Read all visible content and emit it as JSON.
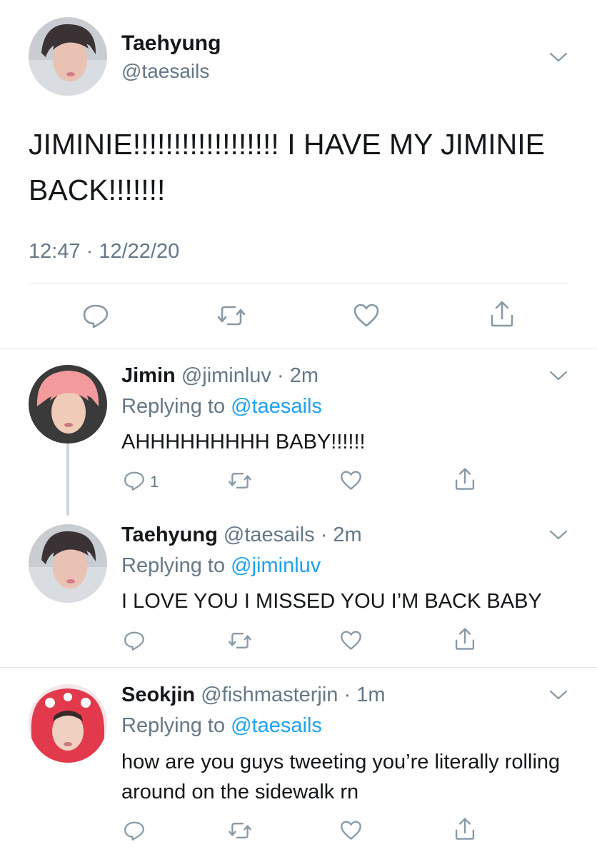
{
  "main_tweet": {
    "display_name": "Taehyung",
    "handle": "@taesails",
    "text": "JIMINIE!!!!!!!!!!!!!!!!!! I HAVE MY JIMINIE BACK!!!!!!!",
    "timestamp": "12:47 · 12/22/20",
    "icons": [
      "reply-icon",
      "retweet-icon",
      "like-icon",
      "share-icon",
      "chevron-down-icon"
    ]
  },
  "replies": [
    {
      "display_name": "Jimin",
      "handle": "@jiminluv",
      "time": "· 2m",
      "replying_prefix": "Replying to",
      "replying_to": "@taesails",
      "text": "AHHHHHHHHH BABY!!!!!!",
      "reply_count": "1"
    },
    {
      "display_name": "Taehyung",
      "handle": "@taesails",
      "time": "· 2m",
      "replying_prefix": "Replying to",
      "replying_to": "@jiminluv",
      "text": "I LOVE YOU I MISSED YOU I’M BACK BABY",
      "reply_count": ""
    },
    {
      "display_name": "Seokjin",
      "handle": "@fishmasterjin",
      "time": "· 1m",
      "replying_prefix": "Replying to",
      "replying_to": "@taesails",
      "text": "how are you guys tweeting you’re literally rolling around on the sidewalk rn",
      "reply_count": ""
    }
  ],
  "colors": {
    "text": "#14171a",
    "secondary": "#657786",
    "accent": "#1da1f2",
    "divider": "#e1e8ed"
  }
}
